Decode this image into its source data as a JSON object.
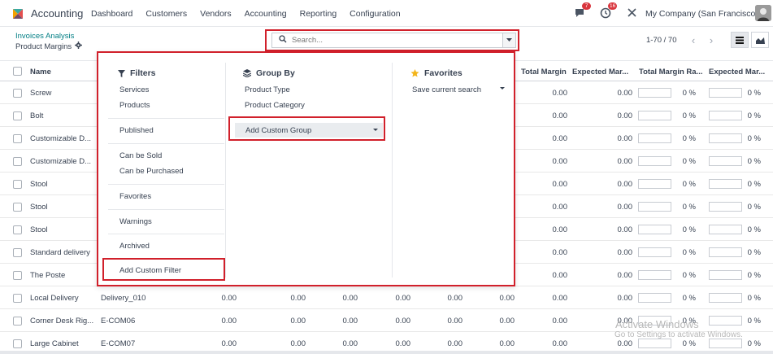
{
  "navbar": {
    "app_name": "Accounting",
    "menu": [
      "Dashboard",
      "Customers",
      "Vendors",
      "Accounting",
      "Reporting",
      "Configuration"
    ],
    "messages_count": "7",
    "activity_count": "16",
    "company": "My Company (San Francisco)"
  },
  "breadcrumb": {
    "parent": "Invoices Analysis",
    "current": "Product Margins"
  },
  "search": {
    "placeholder": "Search..."
  },
  "pager": {
    "text": "1-70 / 70"
  },
  "table": {
    "headers": {
      "name": "Name",
      "total_margin": "Total Margin",
      "expected_margin": "Expected Mar...",
      "total_margin_rate": "Total Margin Ra...",
      "expected_margin_rate": "Expected Mar..."
    },
    "rows": [
      {
        "name": "Screw",
        "ref": "",
        "c1": "",
        "c2": "",
        "c3": "",
        "c4": "",
        "c5": "",
        "c6": "",
        "total_margin": "0.00",
        "expected_margin": "0.00",
        "tm_rate": "0 %",
        "em_rate": "0 %"
      },
      {
        "name": "Bolt",
        "ref": "",
        "c1": "",
        "c2": "",
        "c3": "",
        "c4": "",
        "c5": "",
        "c6": "",
        "total_margin": "0.00",
        "expected_margin": "0.00",
        "tm_rate": "0 %",
        "em_rate": "0 %"
      },
      {
        "name": "Customizable D...",
        "ref": "",
        "c1": "",
        "c2": "",
        "c3": "",
        "c4": "",
        "c5": "",
        "c6": "",
        "total_margin": "0.00",
        "expected_margin": "0.00",
        "tm_rate": "0 %",
        "em_rate": "0 %"
      },
      {
        "name": "Customizable D...",
        "ref": "",
        "c1": "",
        "c2": "",
        "c3": "",
        "c4": "",
        "c5": "",
        "c6": "",
        "total_margin": "0.00",
        "expected_margin": "0.00",
        "tm_rate": "0 %",
        "em_rate": "0 %"
      },
      {
        "name": "Stool",
        "ref": "",
        "c1": "",
        "c2": "",
        "c3": "",
        "c4": "",
        "c5": "",
        "c6": "",
        "total_margin": "0.00",
        "expected_margin": "0.00",
        "tm_rate": "0 %",
        "em_rate": "0 %"
      },
      {
        "name": "Stool",
        "ref": "",
        "c1": "",
        "c2": "",
        "c3": "",
        "c4": "",
        "c5": "",
        "c6": "",
        "total_margin": "0.00",
        "expected_margin": "0.00",
        "tm_rate": "0 %",
        "em_rate": "0 %"
      },
      {
        "name": "Stool",
        "ref": "",
        "c1": "",
        "c2": "",
        "c3": "",
        "c4": "",
        "c5": "",
        "c6": "",
        "total_margin": "0.00",
        "expected_margin": "0.00",
        "tm_rate": "0 %",
        "em_rate": "0 %"
      },
      {
        "name": "Standard delivery",
        "ref": "",
        "c1": "",
        "c2": "",
        "c3": "",
        "c4": "",
        "c5": "",
        "c6": "",
        "total_margin": "0.00",
        "expected_margin": "0.00",
        "tm_rate": "0 %",
        "em_rate": "0 %"
      },
      {
        "name": "The Poste",
        "ref": "",
        "c1": "",
        "c2": "",
        "c3": "",
        "c4": "",
        "c5": "",
        "c6": "",
        "total_margin": "0.00",
        "expected_margin": "0.00",
        "tm_rate": "0 %",
        "em_rate": "0 %"
      },
      {
        "name": "Local Delivery",
        "ref": "Delivery_010",
        "c1": "0.00",
        "c2": "0.00",
        "c3": "0.00",
        "c4": "0.00",
        "c5": "0.00",
        "c6": "0.00",
        "total_margin": "0.00",
        "expected_margin": "0.00",
        "tm_rate": "0 %",
        "em_rate": "0 %"
      },
      {
        "name": "Corner Desk Rig...",
        "ref": "E-COM06",
        "c1": "0.00",
        "c2": "0.00",
        "c3": "0.00",
        "c4": "0.00",
        "c5": "0.00",
        "c6": "0.00",
        "total_margin": "0.00",
        "expected_margin": "0.00",
        "tm_rate": "0 %",
        "em_rate": "0 %"
      },
      {
        "name": "Large Cabinet",
        "ref": "E-COM07",
        "c1": "0.00",
        "c2": "0.00",
        "c3": "0.00",
        "c4": "0.00",
        "c5": "0.00",
        "c6": "0.00",
        "total_margin": "0.00",
        "expected_margin": "0.00",
        "tm_rate": "0 %",
        "em_rate": "0 %"
      }
    ]
  },
  "dropdown": {
    "filters": {
      "title": "Filters",
      "items": [
        "Services",
        "Products",
        "Published",
        "Can be Sold",
        "Can be Purchased",
        "Favorites",
        "Warnings",
        "Archived",
        "Add Custom Filter"
      ]
    },
    "group_by": {
      "title": "Group By",
      "items": [
        "Product Type",
        "Product Category"
      ],
      "custom": "Add Custom Group"
    },
    "favorites": {
      "title": "Favorites",
      "save": "Save current search"
    }
  },
  "watermark": {
    "line1": "Activate Windows",
    "line2": "Go to Settings to activate Windows."
  },
  "colors": {
    "accent": "#017e84",
    "highlight": "#d1202b",
    "badge": "#d9363e"
  }
}
